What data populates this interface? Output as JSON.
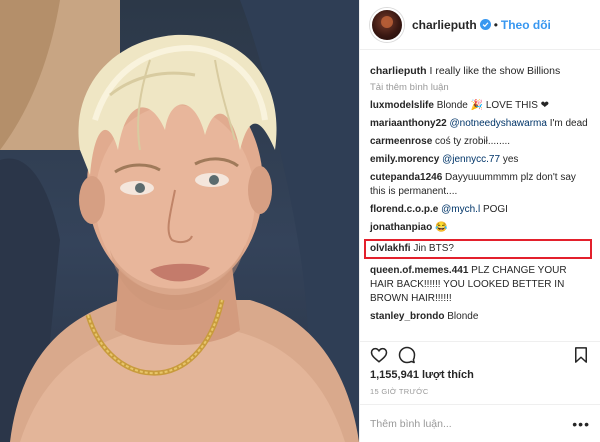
{
  "header": {
    "username": "charlieputh",
    "follow_label": "Theo dõi",
    "separator": "•"
  },
  "caption": {
    "user": "charlieputh",
    "text": "I really like the show Billions"
  },
  "load_more": "Tải thêm bình luận",
  "comments": [
    {
      "user": "luxmodelslife",
      "text": "Blonde 🎉 LOVE THIS ❤"
    },
    {
      "user": "mariaanthony22",
      "mention": "@notneedyshawarma",
      "text": "I'm dead"
    },
    {
      "user": "carmeenrose",
      "text": "coś ty zrobił........"
    },
    {
      "user": "emily.morency",
      "mention": "@jennycc.77",
      "text": "yes"
    },
    {
      "user": "cutepanda1246",
      "text": "Dayyuuummmm plz don't say this is permanent...."
    },
    {
      "user": "florend.c.o.p.e",
      "mention": "@mych.l",
      "text": "POGI"
    },
    {
      "user": "jonathanpiao",
      "text": "😂"
    },
    {
      "user": "olvlakhfi",
      "text": "Jin BTS?",
      "highlighted": true
    },
    {
      "user": "queen.of.memes.441",
      "text": "PLZ CHANGE YOUR HAIR BACK!!!!!! YOU LOOKED BETTER IN BROWN HAIR!!!!!!"
    },
    {
      "user": "stanley_brondo",
      "text": "Blonde"
    }
  ],
  "likes": "1,155,941 lượt thích",
  "timestamp": "15 GIỜ TRƯỚC",
  "add_comment": {
    "placeholder": "Thêm bình luận...",
    "more": "•••"
  },
  "icons": {
    "like": "heart-icon",
    "comment": "comment-bubble-icon",
    "save": "bookmark-icon",
    "verified": "verified-badge-icon"
  },
  "colors": {
    "link_blue": "#3897f0",
    "highlight_red": "#e3202c",
    "muted_grey": "#999999",
    "text": "#262626"
  }
}
